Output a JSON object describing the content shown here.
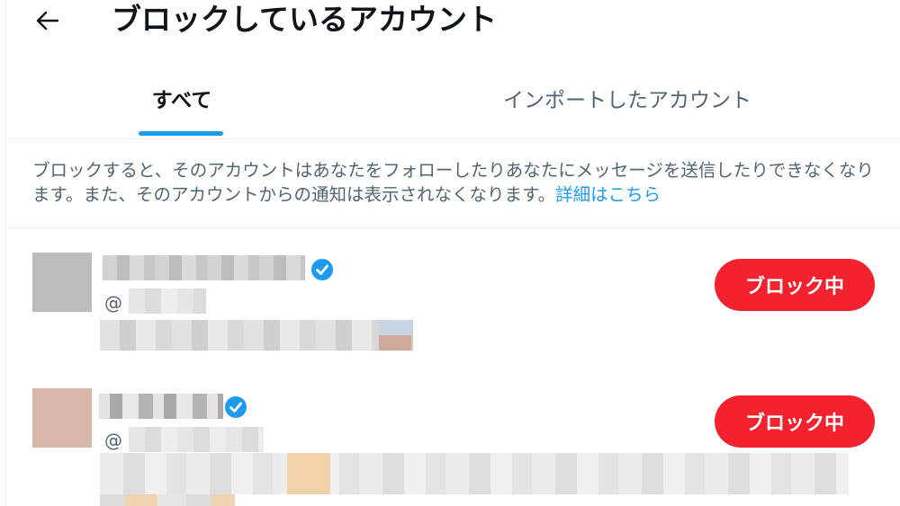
{
  "header": {
    "back_icon": "arrow-left-icon",
    "title": "ブロックしているアカウント"
  },
  "tabs": [
    {
      "label": "すべて",
      "active": true
    },
    {
      "label": "インポートしたアカウント",
      "active": false
    }
  ],
  "colors": {
    "accent": "#1d9bf0",
    "block_button": "#f4212e",
    "secondary_text": "#536471"
  },
  "description": {
    "text": "ブロックすると、そのアカウントはあなたをフォローしたりあなたにメッセージを送信したりできなくなります。また、そのアカウントからの通知は表示されなくなります。",
    "link": "詳細はこちら"
  },
  "accounts": [
    {
      "handle_prefix": "@",
      "verified": true,
      "button_label": "ブロック中"
    },
    {
      "handle_prefix": "@",
      "verified": true,
      "button_label": "ブロック中"
    }
  ]
}
